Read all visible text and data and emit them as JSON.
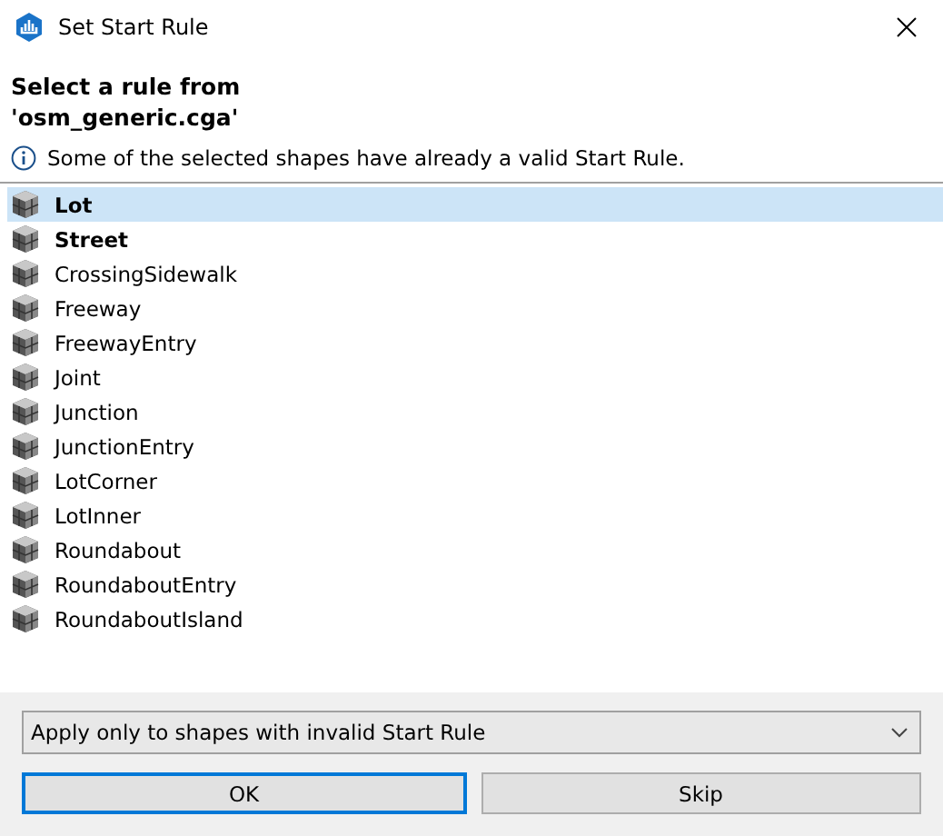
{
  "window": {
    "title": "Set Start Rule"
  },
  "header": {
    "title": "Select a rule from\n'osm_generic.cga'",
    "message": "Some of the selected shapes have already a valid Start Rule."
  },
  "rules": [
    {
      "label": "Lot",
      "bold": true,
      "selected": true
    },
    {
      "label": "Street",
      "bold": true,
      "selected": false
    },
    {
      "label": "CrossingSidewalk",
      "bold": false,
      "selected": false
    },
    {
      "label": "Freeway",
      "bold": false,
      "selected": false
    },
    {
      "label": "FreewayEntry",
      "bold": false,
      "selected": false
    },
    {
      "label": "Joint",
      "bold": false,
      "selected": false
    },
    {
      "label": "Junction",
      "bold": false,
      "selected": false
    },
    {
      "label": "JunctionEntry",
      "bold": false,
      "selected": false
    },
    {
      "label": "LotCorner",
      "bold": false,
      "selected": false
    },
    {
      "label": "LotInner",
      "bold": false,
      "selected": false
    },
    {
      "label": "Roundabout",
      "bold": false,
      "selected": false
    },
    {
      "label": "RoundaboutEntry",
      "bold": false,
      "selected": false
    },
    {
      "label": "RoundaboutIsland",
      "bold": false,
      "selected": false
    }
  ],
  "apply_mode": {
    "value": "Apply only to shapes with invalid Start Rule"
  },
  "buttons": [
    {
      "label": "OK",
      "default": true
    },
    {
      "label": "Skip",
      "default": false
    }
  ]
}
